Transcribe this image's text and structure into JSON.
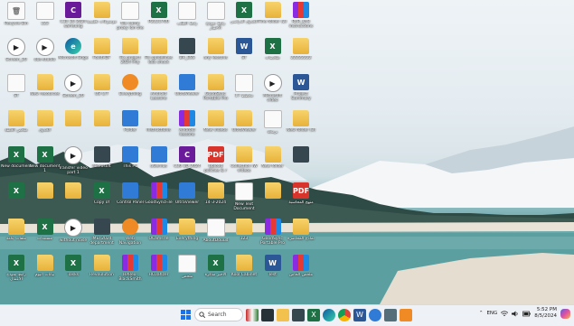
{
  "desktop": {
    "icons": [
      {
        "label": "Recycle Bin",
        "glyph": "🗑",
        "kind": "doc"
      },
      {
        "label": "123",
        "glyph": "",
        "kind": "doc"
      },
      {
        "label": "C30 30 2024 samsung",
        "glyph": "C",
        "kind": "app"
      },
      {
        "label": "موضوعات تعليمية",
        "glyph": "",
        "kind": "folder"
      },
      {
        "label": "file name proxy lon the",
        "glyph": "",
        "kind": "doc"
      },
      {
        "label": "P2121700",
        "glyph": "X",
        "kind": "excel"
      },
      {
        "label": "رابط الطلب",
        "glyph": "",
        "kind": "doc"
      },
      {
        "label": "رابط نموذج الاختيار",
        "glyph": "",
        "kind": "doc"
      },
      {
        "label": "الجدول الدراسي",
        "glyph": "X",
        "kind": "excel"
      },
      {
        "label": "Fine folder (2)",
        "glyph": "",
        "kind": "folder"
      },
      {
        "label": "RAR_Kh3 instructions",
        "glyph": "",
        "kind": "rar"
      },
      {
        "label": "Screen_20",
        "glyph": "▶",
        "kind": "video"
      },
      {
        "label": "obs-studio",
        "glyph": "▶",
        "kind": "video"
      },
      {
        "label": "Microsoft Edge",
        "glyph": "e",
        "kind": "edge"
      },
      {
        "label": "FoxitPDF",
        "glyph": "",
        "kind": "folder"
      },
      {
        "label": "Fix project 2024 Phy",
        "glyph": "",
        "kind": "folder"
      },
      {
        "label": "Fix guidelines loot shock",
        "glyph": "",
        "kind": "folder"
      },
      {
        "label": "BR_ESS",
        "glyph": "",
        "kind": "dark"
      },
      {
        "label": "any lessons",
        "glyph": "",
        "kind": "folder"
      },
      {
        "label": "ST",
        "glyph": "W",
        "kind": "word"
      },
      {
        "label": "ملخصات",
        "glyph": "X",
        "kind": "excel"
      },
      {
        "label": "22222222",
        "glyph": "",
        "kind": "folder"
      },
      {
        "label": "ST",
        "glyph": "",
        "kind": "doc"
      },
      {
        "label": "New resources",
        "glyph": "",
        "kind": "folder"
      },
      {
        "label": "Screen_20",
        "glyph": "▶",
        "kind": "video"
      },
      {
        "label": "US C/T",
        "glyph": "",
        "kind": "folder"
      },
      {
        "label": "Everything",
        "glyph": "",
        "kind": "orange"
      },
      {
        "label": "Android Lessons",
        "glyph": "",
        "kind": "folder"
      },
      {
        "label": "UltraViewer",
        "glyph": "",
        "kind": "blue"
      },
      {
        "label": "GoodSync Portable Pro",
        "glyph": "",
        "kind": "folder"
      },
      {
        "label": "مخطط 17",
        "glyph": "",
        "kind": "doc"
      },
      {
        "label": "Microsoft video",
        "glyph": "▶",
        "kind": "video"
      },
      {
        "label": "Project Summary",
        "glyph": "W",
        "kind": "word"
      },
      {
        "label": "ملخص الخطة",
        "glyph": "",
        "kind": "folder"
      },
      {
        "label": "الجدول",
        "glyph": "",
        "kind": "folder"
      },
      {
        "label": "",
        "glyph": "",
        "kind": "folder"
      },
      {
        "label": "",
        "glyph": "",
        "kind": "folder"
      },
      {
        "label": "Folder",
        "glyph": "",
        "kind": "blue"
      },
      {
        "label": "Instructions",
        "glyph": "",
        "kind": "folder"
      },
      {
        "label": "Android lessons",
        "glyph": "",
        "kind": "rar"
      },
      {
        "label": "New videos",
        "glyph": "",
        "kind": "folder"
      },
      {
        "label": "UltraViewer",
        "glyph": "",
        "kind": "folder"
      },
      {
        "label": "برمجة",
        "glyph": "",
        "kind": "doc"
      },
      {
        "label": "New folder (3)",
        "glyph": "",
        "kind": "folder"
      },
      {
        "label": "New document",
        "glyph": "X",
        "kind": "excel"
      },
      {
        "label": "New document 1",
        "glyph": "X",
        "kind": "excel"
      },
      {
        "label": "Transfer video part 1",
        "glyph": "▶",
        "kind": "video"
      },
      {
        "label": "Microsoft",
        "glyph": "",
        "kind": "dark"
      },
      {
        "label": "This PC",
        "glyph": "",
        "kind": "blue"
      },
      {
        "label": "uGenius",
        "glyph": "",
        "kind": "blue"
      },
      {
        "label": "C30 3D 2024",
        "glyph": "C",
        "kind": "app"
      },
      {
        "label": "Upload policies & r",
        "glyph": "PDF",
        "kind": "pdf"
      },
      {
        "label": "Collection IW videos",
        "glyph": "",
        "kind": "folder"
      },
      {
        "label": "New folder",
        "glyph": "",
        "kind": "folder"
      },
      {
        "label": "",
        "glyph": "",
        "kind": "dark"
      },
      {
        "label": "",
        "glyph": "X",
        "kind": "excel"
      },
      {
        "label": "",
        "glyph": "",
        "kind": "folder"
      },
      {
        "label": "",
        "glyph": "",
        "kind": "folder"
      },
      {
        "label": "Copy of",
        "glyph": "X",
        "kind": "excel"
      },
      {
        "label": "Control Panel",
        "glyph": "",
        "kind": "blue"
      },
      {
        "label": "GoodSyncFile",
        "glyph": "",
        "kind": "rar"
      },
      {
        "label": "UltraViewer",
        "glyph": "",
        "kind": "blue"
      },
      {
        "label": "14-3-2024",
        "glyph": "",
        "kind": "folder"
      },
      {
        "label": "New Text Document",
        "glyph": "",
        "kind": "doc"
      },
      {
        "label": "",
        "glyph": "",
        "kind": "folder"
      },
      {
        "label": "منهج المحاسبة",
        "glyph": "PDF",
        "kind": "pdf"
      },
      {
        "label": "ملفات عامة",
        "glyph": "",
        "kind": "folder"
      },
      {
        "label": "مستندات",
        "glyph": "X",
        "kind": "excel"
      },
      {
        "label": "without noise",
        "glyph": "▶",
        "kind": "video"
      },
      {
        "label": "IMEI 2024 department",
        "glyph": "",
        "kind": "dark"
      },
      {
        "label": "Web Navigation",
        "glyph": "",
        "kind": "orange"
      },
      {
        "label": "OCamsrle",
        "glyph": "",
        "kind": "rar"
      },
      {
        "label": "Everything",
        "glyph": "",
        "kind": "folder"
      },
      {
        "label": "AboutDouud",
        "glyph": "",
        "kind": "doc"
      },
      {
        "label": "123",
        "glyph": "",
        "kind": "folder"
      },
      {
        "label": "GoodSync Portable Pro",
        "glyph": "",
        "kind": "rar"
      },
      {
        "label": "نماذج المحاضرة",
        "glyph": "",
        "kind": "folder"
      },
      {
        "label": "رابط نموذج الأعمال",
        "glyph": "X",
        "kind": "excel"
      },
      {
        "label": "بيانات اليوم",
        "glyph": "",
        "kind": "folder"
      },
      {
        "label": "Tasks",
        "glyph": "X",
        "kind": "excel"
      },
      {
        "label": "Revoulution",
        "glyph": "",
        "kind": "folder"
      },
      {
        "label": "HPRex-BlackSmith",
        "glyph": "",
        "kind": "rar"
      },
      {
        "label": "HC0ahzer",
        "glyph": "",
        "kind": "rar"
      },
      {
        "label": "ملخص",
        "glyph": "",
        "kind": "doc"
      },
      {
        "label": "الأخير مذكرة",
        "glyph": "X",
        "kind": "excel"
      },
      {
        "label": "Kool Cabinet",
        "glyph": "",
        "kind": "folder"
      },
      {
        "label": "Test",
        "glyph": "W",
        "kind": "word"
      },
      {
        "label": "ملخص الخاص",
        "glyph": "",
        "kind": "rar"
      },
      {
        "label": "lecture_ocr_info",
        "glyph": "",
        "kind": "folder"
      },
      {
        "label": "Interaction",
        "glyph": "▶",
        "kind": "video"
      }
    ]
  },
  "taskbar": {
    "search_label": "Search",
    "tray": {
      "language": "ENG",
      "time": "5:52 PM",
      "date": "8/5/2024"
    }
  }
}
